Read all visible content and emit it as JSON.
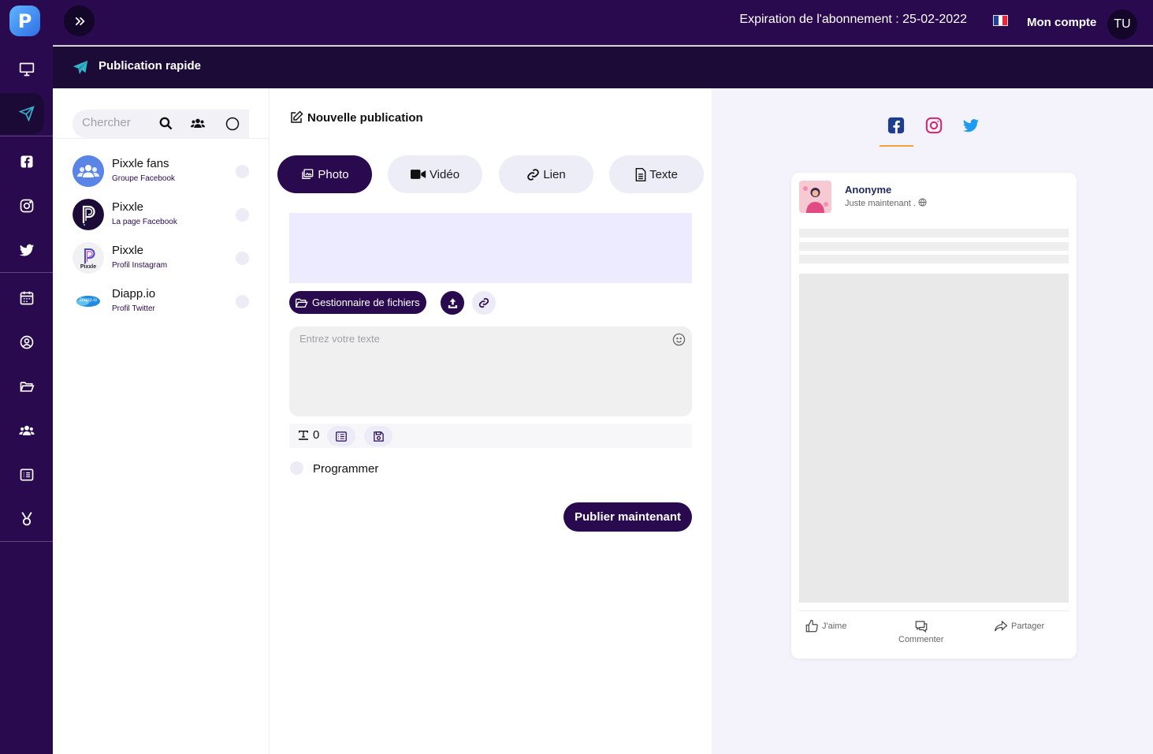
{
  "header": {
    "expiry_text": "Expiration de l'abonnement : 25-02-2022",
    "account_label": "Mon compte",
    "avatar_initials": "TU",
    "flag_colors": [
      "#1f3f9e",
      "#ffffff",
      "#e8283a"
    ]
  },
  "subheader": {
    "title": "Publication rapide"
  },
  "rail": {
    "logo_letter": "P",
    "items": [
      "desktop-icon",
      "send-icon",
      "facebook-icon",
      "instagram-icon",
      "twitter-icon",
      "calendar-icon",
      "user-circle-icon",
      "folder-icon",
      "users-icon",
      "list-icon",
      "medal-icon"
    ],
    "active": "send-icon"
  },
  "search": {
    "placeholder": "Chercher"
  },
  "accounts": [
    {
      "name": "Pixxle fans",
      "type": "Groupe Facebook"
    },
    {
      "name": "Pixxle",
      "type": "La page Facebook"
    },
    {
      "name": "Pixxle",
      "type": "Profil Instagram",
      "logo_caption": "Pixxle"
    },
    {
      "name": "Diapp.io",
      "type": "Profil Twitter",
      "logo_caption": "Diapp.io"
    }
  ],
  "compose": {
    "title": "Nouvelle publication",
    "tabs": [
      {
        "label": "Photo",
        "active": true
      },
      {
        "label": "Vidéo",
        "active": false
      },
      {
        "label": "Lien",
        "active": false
      },
      {
        "label": "Texte",
        "active": false
      }
    ],
    "file_manager_label": "Gestionnaire de fichiers",
    "text_placeholder": "Entrez votre texte",
    "counter": "0",
    "schedule_label": "Programmer",
    "publish_label": "Publier maintenant"
  },
  "preview": {
    "networks": [
      "facebook-icon",
      "instagram-icon",
      "twitter-icon"
    ],
    "active_network": "facebook-icon",
    "author": "Anonyme",
    "time": "Juste maintenant .",
    "actions": {
      "like": "J'aime",
      "comment": "Commenter",
      "share": "Partager"
    }
  },
  "colors": {
    "brand_dark": "#2a0a4f",
    "brand_darker": "#1c0a37",
    "accent_teal": "#35b2c9",
    "facebook": "#1e3d8f",
    "instagram": "#d6246e",
    "twitter": "#1d9bf0",
    "underline": "#f0a43a"
  }
}
